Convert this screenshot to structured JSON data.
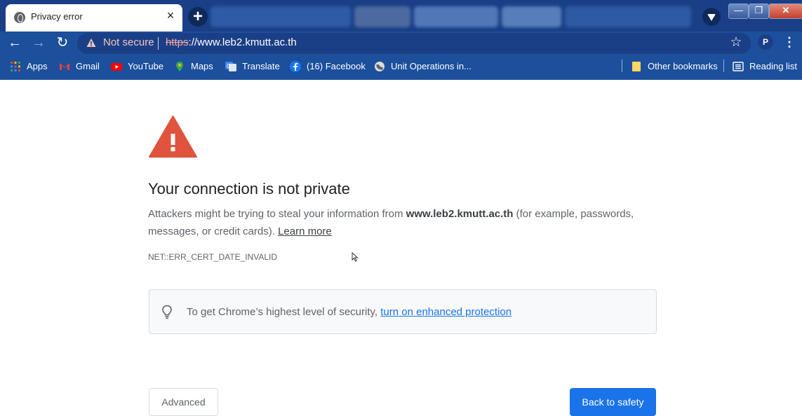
{
  "window": {
    "controls": {
      "minimize": "—",
      "maximize": "❐",
      "close": "✕"
    }
  },
  "tab": {
    "title": "Privacy error",
    "close": "×",
    "new_tab": "+"
  },
  "toolbar": {
    "back": "←",
    "forward": "→",
    "reload": "↻",
    "security_status": "Not secure",
    "url_scheme": "https",
    "url_rest": "://www.leb2.kmutt.ac.th",
    "bookmark_star": "☆",
    "profile_initial": "P",
    "menu": "⋮"
  },
  "bookmarks": {
    "items": [
      {
        "label": "Apps",
        "icon": "apps-grid-icon"
      },
      {
        "label": "Gmail",
        "icon": "gmail-icon"
      },
      {
        "label": "YouTube",
        "icon": "youtube-icon"
      },
      {
        "label": "Maps",
        "icon": "maps-pin-icon"
      },
      {
        "label": "Translate",
        "icon": "translate-icon"
      },
      {
        "label": "(16) Facebook",
        "icon": "facebook-icon"
      },
      {
        "label": "Unit Operations in...",
        "icon": "globe-icon"
      }
    ],
    "other": "Other bookmarks",
    "reading_list": "Reading list"
  },
  "page": {
    "headline": "Your connection is not private",
    "desc_before": "Attackers might be trying to steal your information from ",
    "desc_domain": "www.leb2.kmutt.ac.th",
    "desc_after": " (for example, passwords, messages, or credit cards). ",
    "learn_more": "Learn more",
    "error_code": "NET::ERR_CERT_DATE_INVALID",
    "security_tip": "To get Chrome’s highest level of security, ",
    "security_link": "turn on enhanced protection",
    "advanced_button": "Advanced",
    "back_button": "Back to safety"
  },
  "colors": {
    "chrome_blue": "#1c4f9c",
    "warning_red": "#e0533d",
    "link_blue": "#1a73e8"
  }
}
